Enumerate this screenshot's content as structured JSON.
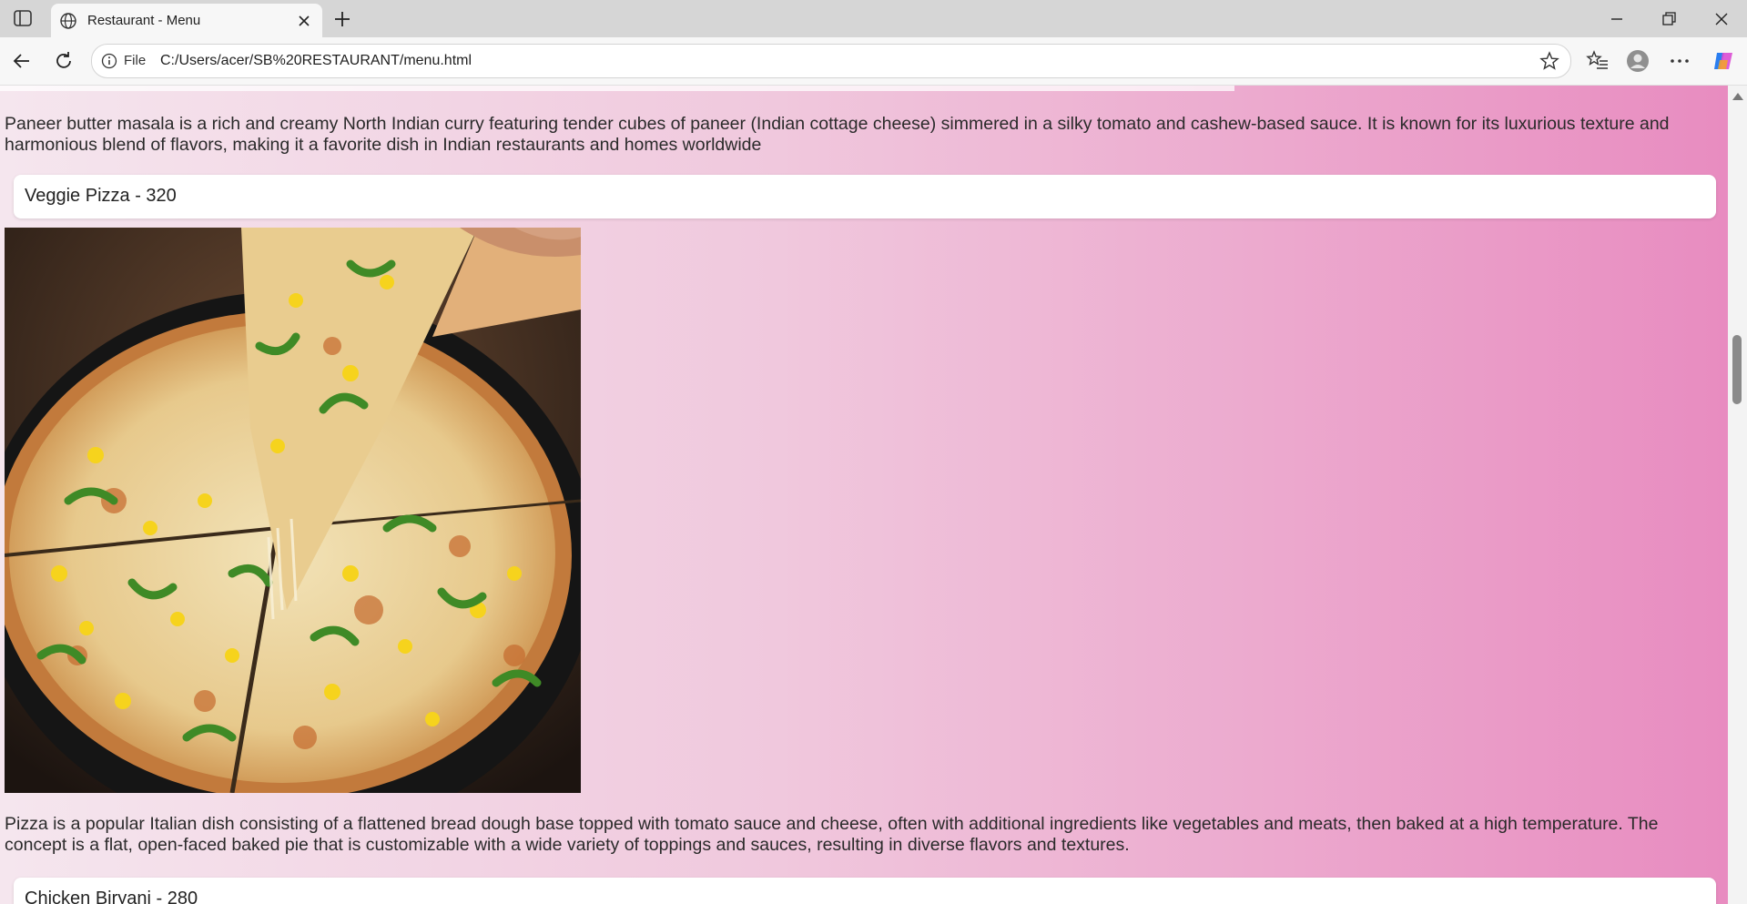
{
  "browser": {
    "tab_title": "Restaurant - Menu",
    "url_scheme": "File",
    "url": "C:/Users/acer/SB%20RESTAURANT/menu.html"
  },
  "menu": {
    "paneer_description": "Paneer butter masala is a rich and creamy North Indian curry featuring tender cubes of paneer (Indian cottage cheese) simmered in a silky tomato and cashew-based sauce. It is known for its luxurious texture and harmonious blend of flavors, making it a favorite dish in Indian restaurants and homes worldwide",
    "items": [
      {
        "label": "Veggie Pizza - 320",
        "image_icon": "pizza-photo",
        "description": "Pizza is a popular Italian dish consisting of a flattened bread dough base topped with tomato sauce and cheese, often with additional ingredients like vegetables and meats, then baked at a high temperature. The concept is a flat, open-faced baked pie that is customizable with a wide variety of toppings and sauces, resulting in diverse flavors and textures."
      },
      {
        "label": "Chicken Biryani - 280"
      }
    ]
  },
  "colors": {
    "gradient_start": "#f5e6ee",
    "gradient_end": "#e88cc0"
  }
}
